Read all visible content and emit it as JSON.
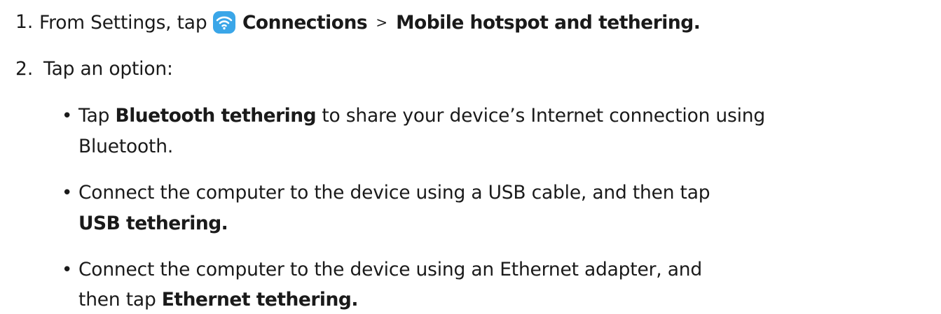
{
  "steps": [
    {
      "number": "1.",
      "prefix": "From Settings, tap",
      "icon": "wifi-icon",
      "path1": "Connections",
      "separator": ">",
      "path2": "Mobile hotspot and tethering."
    },
    {
      "number": "2.",
      "text": "Tap an option:"
    }
  ],
  "options": [
    {
      "bold": "Bluetooth tethering",
      "rest": "to share your device’s Internet connection using",
      "line2": "Bluetooth."
    },
    {
      "text": "Connect the computer to the device using a USB cable, and then tap",
      "bold_line2": "USB tethering."
    },
    {
      "text": "Connect the computer to the device using an Ethernet adapter, and",
      "prefix_line2": "then tap",
      "bold_line2": "Ethernet tethering."
    }
  ],
  "tap_word": "Tap",
  "colors": {
    "text": "#1a1a1a",
    "icon_bg": "#3aa6e8",
    "icon_fg": "#ffffff"
  }
}
